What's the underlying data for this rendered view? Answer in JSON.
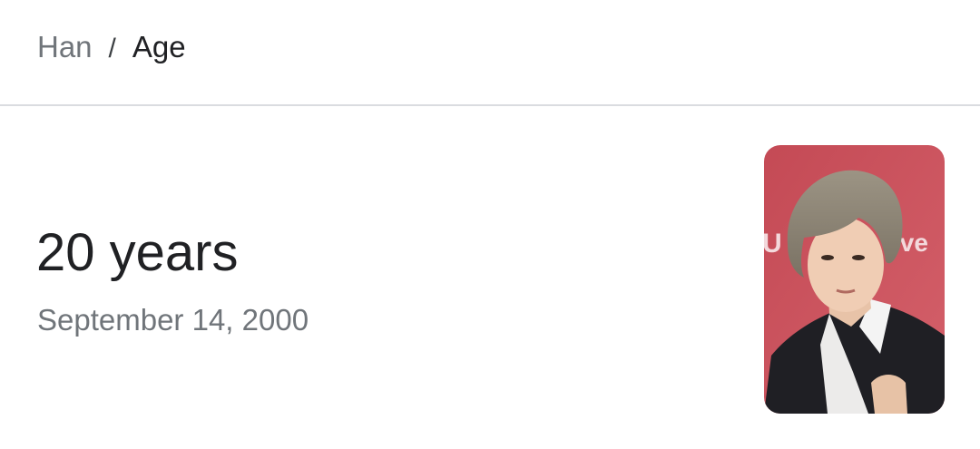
{
  "breadcrumb": {
    "parent": "Han",
    "separator": "/",
    "current": "Age"
  },
  "answer": {
    "value": "20 years",
    "date_of_birth": "September 14, 2000"
  },
  "photo": {
    "subject": "portrait photo of Han",
    "background_color": "#c9505a",
    "backdrop_text_left": "U",
    "backdrop_text_right": "ive"
  }
}
